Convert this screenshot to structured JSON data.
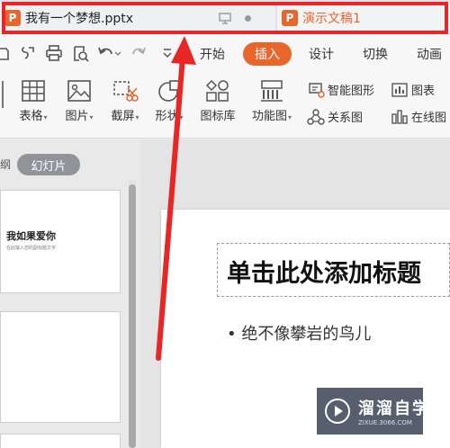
{
  "tabs": [
    {
      "title": "我有一个梦想.pptx",
      "active": true
    },
    {
      "title": "演示文稿1",
      "active": false
    }
  ],
  "tab_logo_letter": "P",
  "accent_color": "#e8652c",
  "highlight_color": "#e82626",
  "quick_access": [
    "open-icon",
    "save-as-icon",
    "print-icon",
    "print-preview-icon",
    "undo-icon",
    "redo-icon",
    "customize-icon"
  ],
  "menu": {
    "items": [
      "开始",
      "插入",
      "设计",
      "切换",
      "动画"
    ],
    "active": "插入"
  },
  "ribbon": {
    "table": "表格",
    "picture": "图片",
    "screenshot": "截屏",
    "shape": "形状",
    "icon_library": "图标库",
    "function_chart": "功能图",
    "smart_art": "智能图形",
    "chart": "图表",
    "relation": "关系图",
    "online_chart": "在线图"
  },
  "pane": {
    "outline_tab": "纲",
    "slides_tab": "幻灯片"
  },
  "thumbnails": [
    {
      "title": "我如果爱你",
      "subtitle": "在此输入您的副标题文字"
    }
  ],
  "slide": {
    "title": "单击此处添加标题",
    "bullet": "绝不像攀岩的鸟儿"
  },
  "watermark": {
    "cn": "溜溜自学",
    "url": "ZIXUE.3066.COM"
  }
}
